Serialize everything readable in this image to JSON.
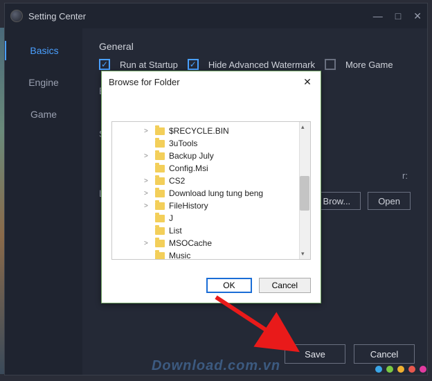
{
  "window": {
    "title": "Setting Center",
    "buttons": {
      "min": "—",
      "max": "□",
      "close": "✕"
    }
  },
  "sidebar": {
    "items": [
      {
        "label": "Basics",
        "active": true
      },
      {
        "label": "Engine",
        "active": false
      },
      {
        "label": "Game",
        "active": false
      }
    ]
  },
  "content": {
    "general_title": "General",
    "checkboxes": {
      "run_startup": {
        "label": "Run at Startup",
        "checked": true
      },
      "hide_watermark": {
        "label": "Hide Advanced Watermark",
        "checked": true
      },
      "more_game": {
        "label": "More Game",
        "checked": false
      }
    },
    "partials": {
      "bos": "Bos",
      "scr": "Scr",
      "lar": "Lar"
    },
    "fragment": "r:",
    "browse_btn": "Brow...",
    "open_btn": "Open",
    "save_btn": "Save",
    "cancel_btn": "Cancel"
  },
  "modal": {
    "title": "Browse for Folder",
    "close": "✕",
    "folders": [
      {
        "name": "$RECYCLE.BIN",
        "expandable": true
      },
      {
        "name": "3uTools",
        "expandable": false
      },
      {
        "name": "Backup July",
        "expandable": true
      },
      {
        "name": "Config.Msi",
        "expandable": false
      },
      {
        "name": "CS2",
        "expandable": true
      },
      {
        "name": "Download lung tung beng",
        "expandable": true
      },
      {
        "name": "FileHistory",
        "expandable": true
      },
      {
        "name": "J",
        "expandable": false
      },
      {
        "name": "List",
        "expandable": false
      },
      {
        "name": "MSOCache",
        "expandable": true
      },
      {
        "name": "Music",
        "expandable": false
      }
    ],
    "ok_btn": "OK",
    "cancel_btn": "Cancel"
  },
  "watermark": "Download.com.vn",
  "dot_colors": [
    "#3aa6e8",
    "#7ac943",
    "#f0b030",
    "#e8584e",
    "#e23ba0"
  ]
}
